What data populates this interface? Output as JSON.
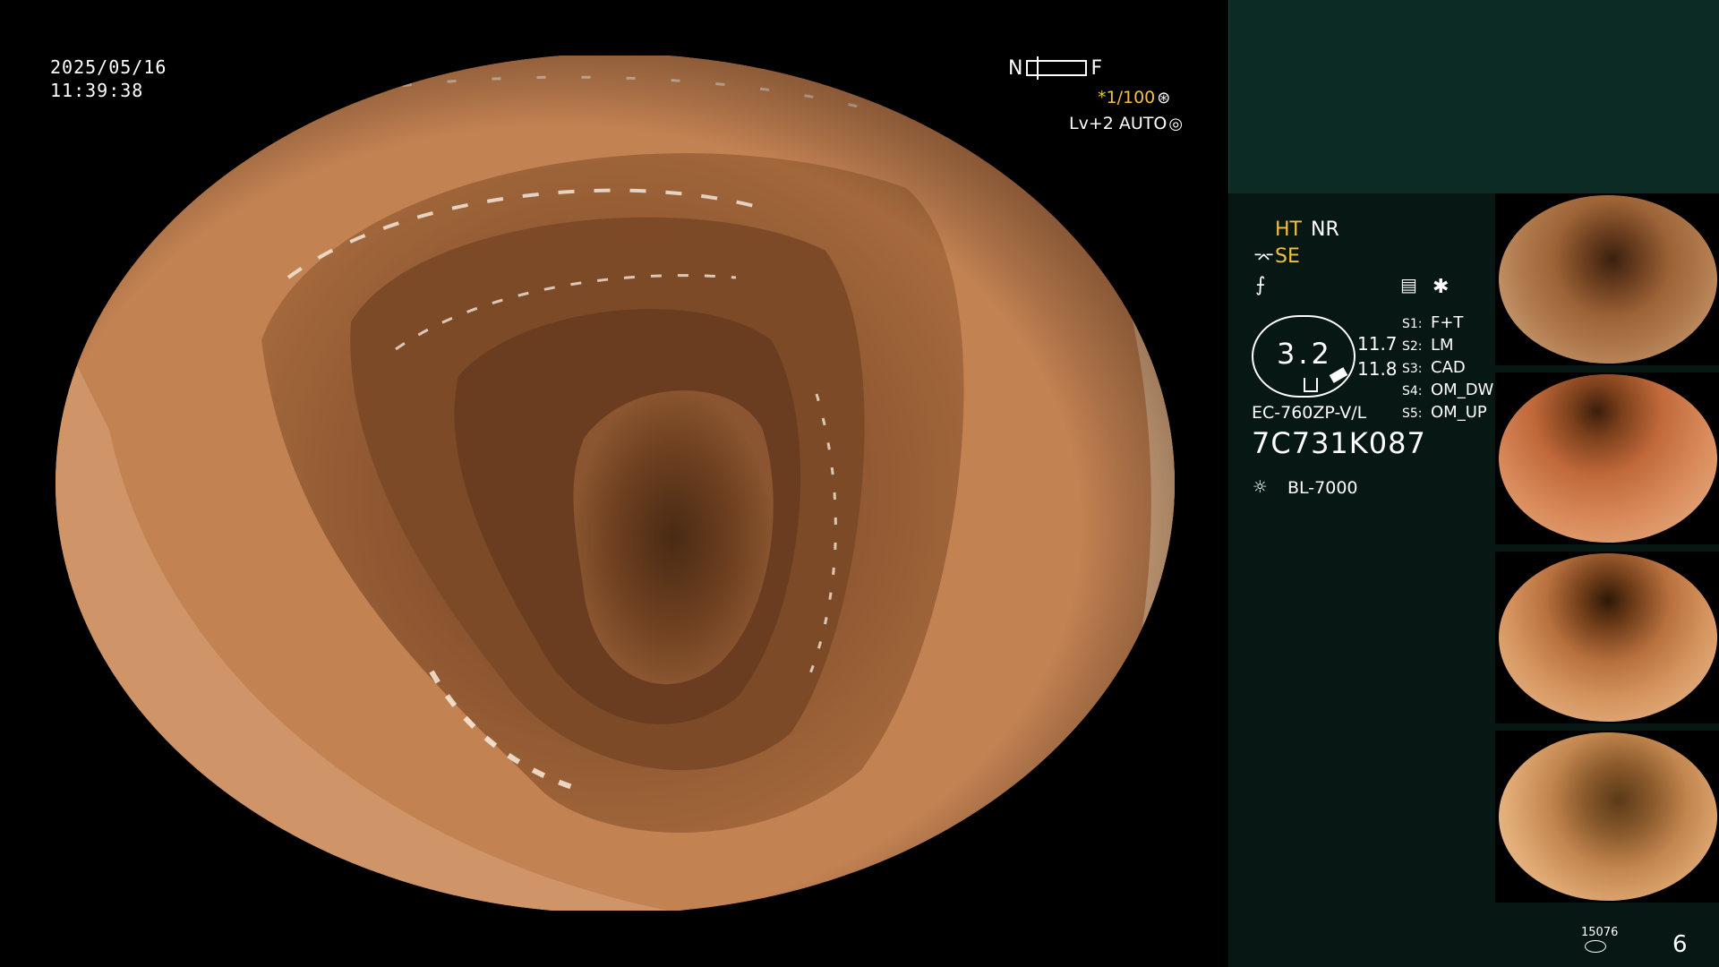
{
  "osd": {
    "date": "2025/05/16",
    "time": "11:39:38",
    "nf_left": "N",
    "nf_right": "F",
    "shutter": "*1/100",
    "level": "Lv+2 AUTO"
  },
  "panel": {
    "enhancement": "HT",
    "noise_reduction": "NR",
    "structure_enhancement": "SE",
    "gauge_value": "3.2",
    "reading_1": "11.7",
    "reading_2": "11.8",
    "switches": [
      {
        "key": "S1:",
        "value": "F+T"
      },
      {
        "key": "S2:",
        "value": "LM"
      },
      {
        "key": "S3:",
        "value": "CAD"
      },
      {
        "key": "S4:",
        "value": "OM_DW"
      },
      {
        "key": "S5:",
        "value": "OM_UP"
      }
    ],
    "scope_model": "EC-760ZP-V/L",
    "scope_serial": "7C731K087",
    "light_source": "BL-7000",
    "image_counter": "15076",
    "page_number": "6"
  },
  "colors": {
    "panel_top": "#0c2b24",
    "panel_main": "#071713",
    "accent_yellow": "#f0c040",
    "mucosa": "#b3703f"
  }
}
